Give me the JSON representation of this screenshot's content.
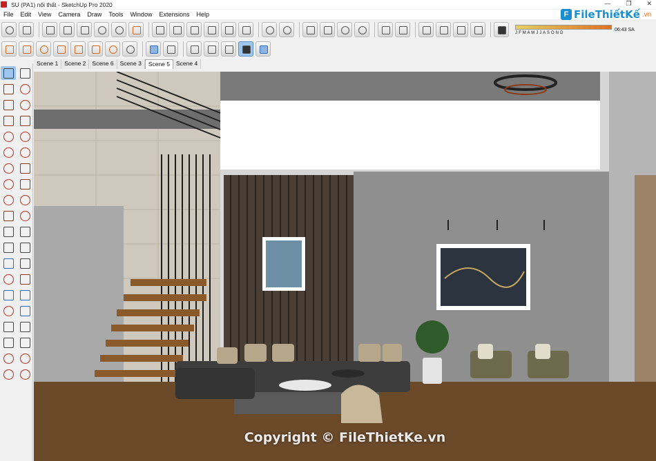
{
  "window": {
    "title": "SU (PA1) nội thất - SketchUp Pro 2020",
    "min": "—",
    "max": "❐",
    "close": "✕"
  },
  "menu": [
    "File",
    "Edit",
    "View",
    "Camera",
    "Draw",
    "Tools",
    "Window",
    "Extensions",
    "Help"
  ],
  "shadow": {
    "months": "J F M A M J J A S O N D",
    "time": "06:43 SA"
  },
  "scenes": [
    "Scene 1",
    "Scene 2",
    "Scene 6",
    "Scene 3",
    "Scene 5",
    "Scene 4"
  ],
  "active_scene": "Scene 5",
  "logo": {
    "mark": "F",
    "name": "FileThiếtKế",
    "tld": ".vn"
  },
  "watermark": "Copyright © FileThietKe.vn",
  "colors": {
    "toolbar_bg": "#f0f0f0",
    "selected": "#9fc6ef",
    "brand": "#1a8fd0",
    "floor": "#6b4a2a",
    "wall": "#8f8f8f"
  }
}
